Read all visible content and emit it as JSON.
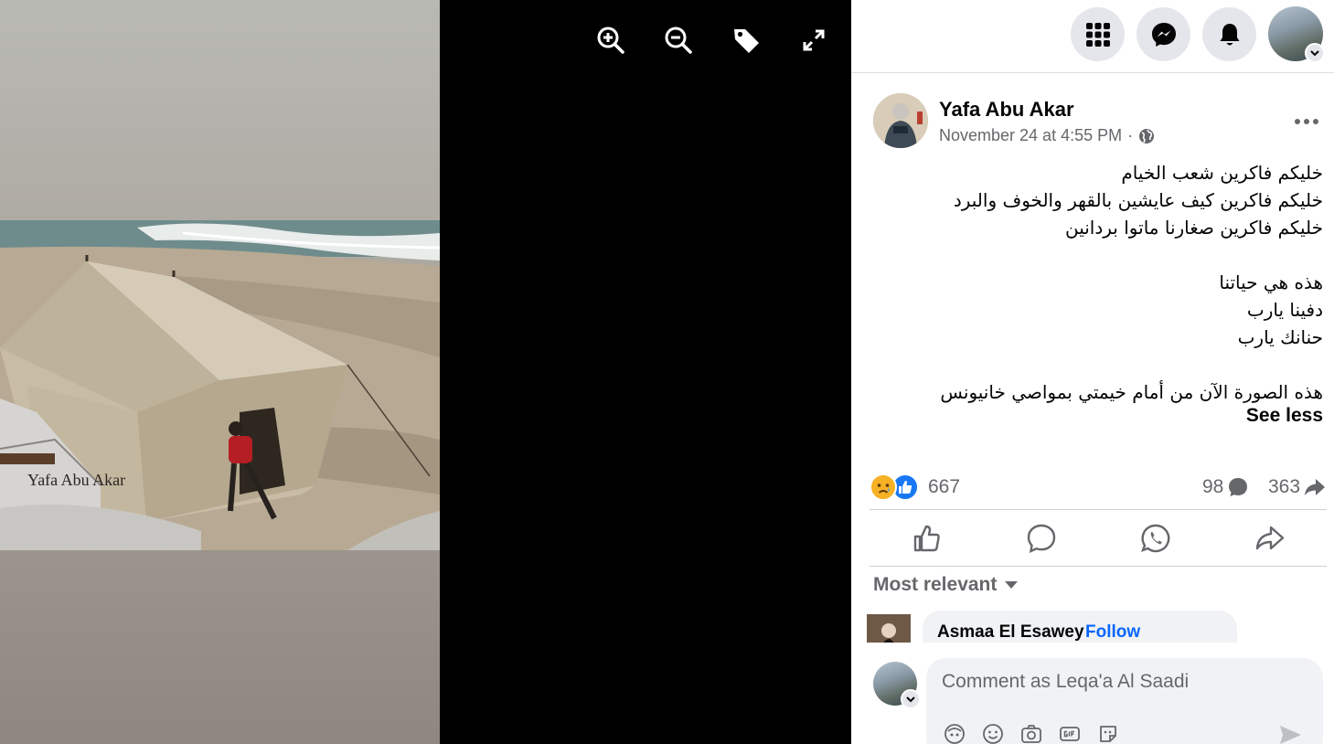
{
  "viewer": {
    "watermark": "Yafa Abu Akar",
    "tools": [
      "zoom-in-icon",
      "zoom-out-icon",
      "tag-icon",
      "fullscreen-icon"
    ]
  },
  "topbar": {
    "icons": [
      "menu-grid-icon",
      "messenger-icon",
      "notifications-bell-icon"
    ],
    "account_chevron": "chevron-down-icon"
  },
  "post": {
    "author": "Yafa Abu Akar",
    "date": "November 24 at 4:55 PM",
    "meta_sep": "·",
    "privacy_icon": "globe-icon",
    "text_lines": [
      "خليكم فاكرين شعب الخيام",
      "خليكم فاكرين كيف عايشين بالقهر والخوف والبرد",
      "خليكم فاكرين صغارنا ماتوا بردانين",
      "",
      "هذه هي حياتنا",
      "دفينا يارب",
      "حنانك يارب",
      "",
      "هذه الصورة الآن من أمام خيمتي بمواصي خانيونس"
    ],
    "see_less": "See less",
    "reactions_count": "667",
    "comments_count": "98",
    "shares_count": "363"
  },
  "actions": [
    "like-icon",
    "comment-icon",
    "whatsapp-icon",
    "share-icon"
  ],
  "comments": {
    "sort_label": "Most relevant",
    "first": {
      "name": "Asmaa El Esawey",
      "sep": "·",
      "follow": "Follow"
    }
  },
  "composer": {
    "placeholder": "Comment as Leqa'a Al Saadi",
    "tools": [
      "avatar-sticker-icon",
      "emoji-icon",
      "camera-icon",
      "gif-icon",
      "sticker-icon"
    ]
  },
  "colors": {
    "accent": "#0866ff",
    "secondary_text": "#65676b",
    "panel_bg": "#ffffff",
    "button_bg": "#e4e6eb"
  }
}
